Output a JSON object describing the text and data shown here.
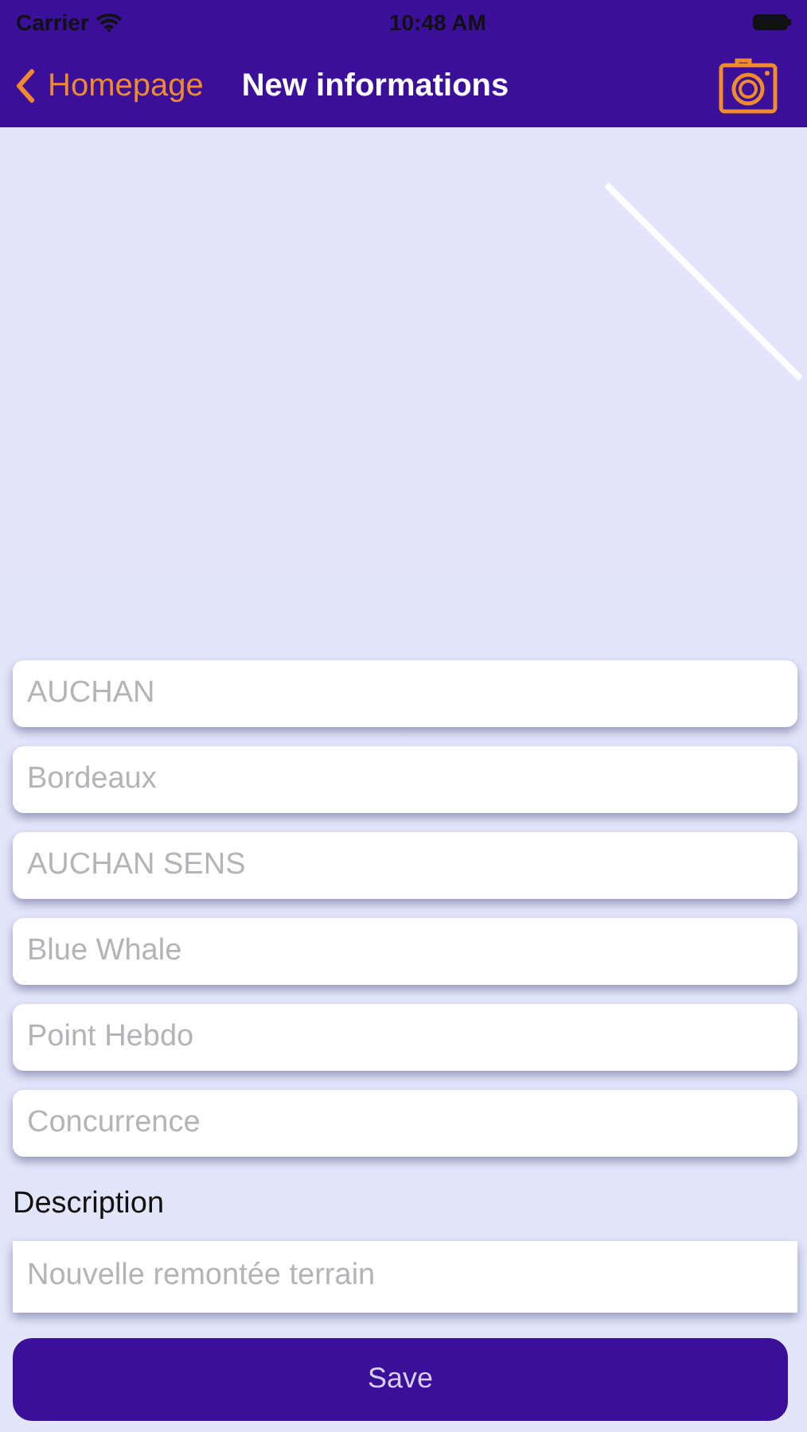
{
  "status_bar": {
    "carrier": "Carrier",
    "time": "10:48 AM"
  },
  "nav": {
    "back": "Homepage",
    "title": "New informations"
  },
  "fields": [
    {
      "placeholder": "AUCHAN"
    },
    {
      "placeholder": "Bordeaux"
    },
    {
      "placeholder": "AUCHAN SENS"
    },
    {
      "placeholder": "Blue Whale"
    },
    {
      "placeholder": "Point Hebdo"
    },
    {
      "placeholder": "Concurrence"
    }
  ],
  "description": {
    "label": "Description",
    "placeholder": "Nouvelle remontée terrain"
  },
  "save_button": "Save"
}
